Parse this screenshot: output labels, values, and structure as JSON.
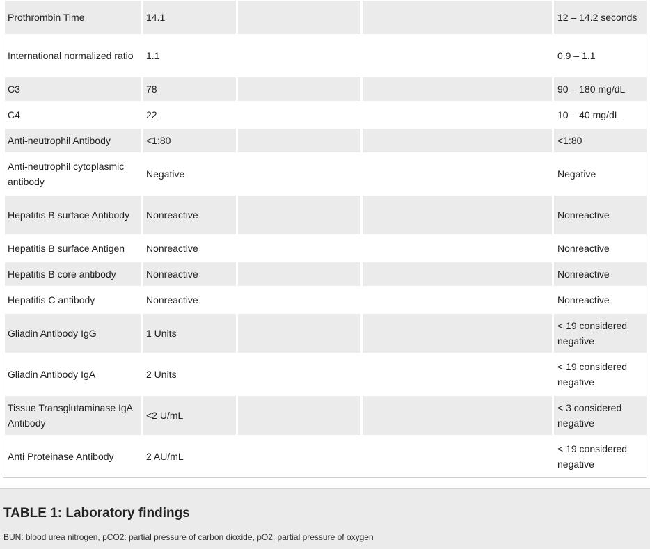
{
  "table": {
    "rows": [
      {
        "test": "Prothrombin Time",
        "result": "14.1",
        "ref": "12 – 14.2 seconds"
      },
      {
        "test": "International normalized ratio",
        "result": "1.1",
        "ref": "0.9 – 1.1"
      },
      {
        "test": "C3",
        "result": "78",
        "ref": "90 – 180 mg/dL"
      },
      {
        "test": "C4",
        "result": "22",
        "ref": "10 – 40 mg/dL"
      },
      {
        "test": "Anti-neutrophil Antibody",
        "result": "<1:80",
        "ref": "<1:80"
      },
      {
        "test": "Anti-neutrophil cytoplasmic antibody",
        "result": "Negative",
        "ref": "Negative"
      },
      {
        "test": "Hepatitis B surface Antibody",
        "result": "Nonreactive",
        "ref": "Nonreactive"
      },
      {
        "test": "Hepatitis B surface Antigen",
        "result": "Nonreactive",
        "ref": "Nonreactive"
      },
      {
        "test": "Hepatitis B core antibody",
        "result": "Nonreactive",
        "ref": "Nonreactive"
      },
      {
        "test": "Hepatitis C antibody",
        "result": "Nonreactive",
        "ref": "Nonreactive"
      },
      {
        "test": "Gliadin Antibody IgG",
        "result": "1 Units",
        "ref": "< 19 considered negative"
      },
      {
        "test": "Gliadin Antibody IgA",
        "result": "2 Units",
        "ref": "< 19 considered negative"
      },
      {
        "test": "Tissue Transglutaminase IgA Antibody",
        "result": "<2 U/mL",
        "ref": "< 3 considered negative"
      },
      {
        "test": "Anti Proteinase Antibody",
        "result": "2 AU/mL",
        "ref": "< 19 considered negative"
      }
    ]
  },
  "caption": {
    "title": "TABLE 1: Laboratory findings",
    "note": "BUN: blood urea nitrogen, pCO2: partial pressure of carbon dioxide, pO2: partial pressure of oxygen"
  }
}
